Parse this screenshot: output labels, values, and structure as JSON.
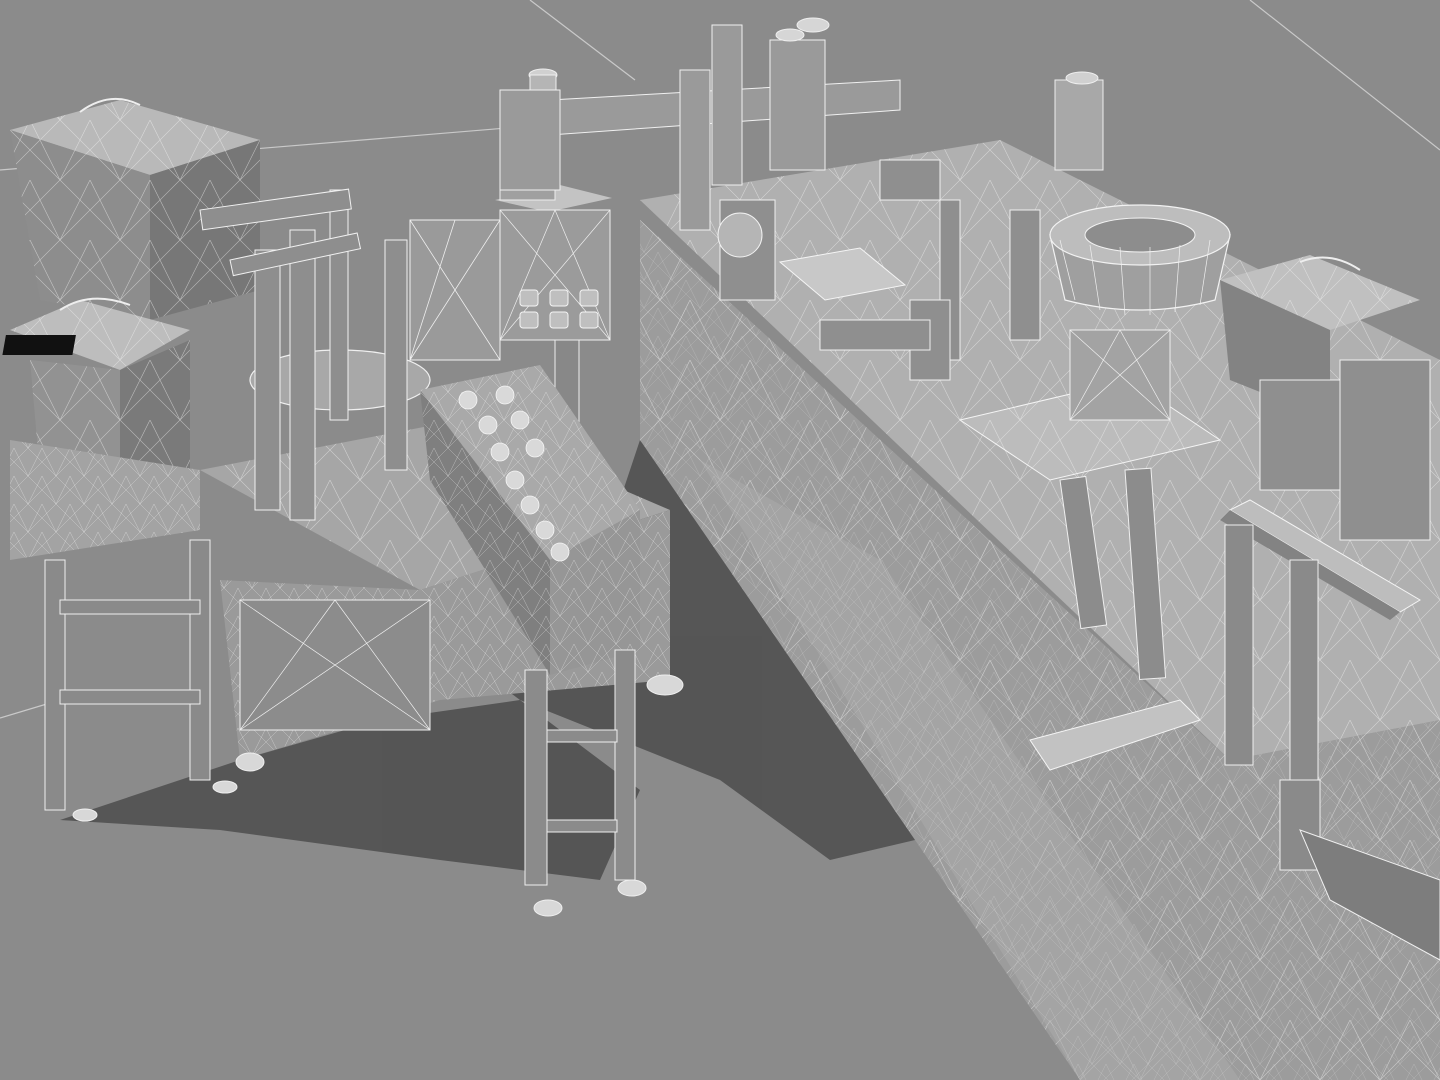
{
  "scene": {
    "subject": "wireframe-render-of-automated-assembly-line",
    "colors": {
      "background": "#8e8e8e",
      "floor": "#8a8a8a",
      "floor_grid": "#c8c8c8",
      "surface_light": "#bdbdbd",
      "surface_mid": "#9c9c9c",
      "surface_dark": "#6e6e6e",
      "shadow": "#4a4a4a",
      "wire": "#f4f4f4"
    }
  }
}
